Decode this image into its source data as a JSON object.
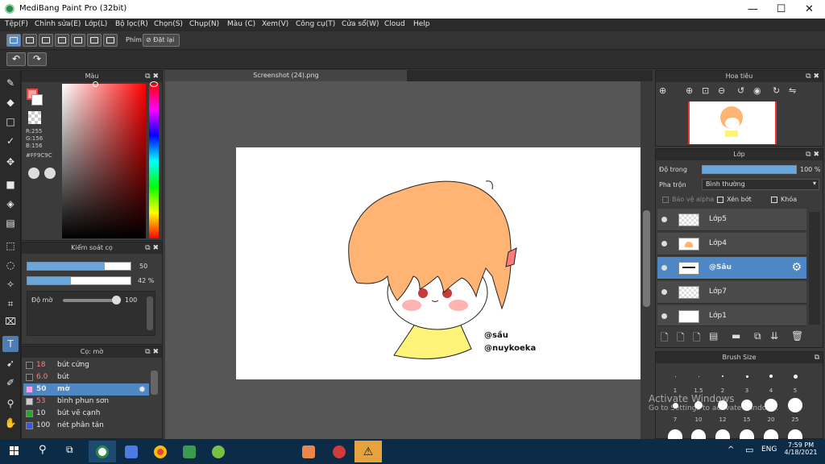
{
  "window": {
    "title": "MediBang Paint Pro (32bit)",
    "min_glyph": "—",
    "max_glyph": "☐",
    "close_glyph": "✕"
  },
  "menu": [
    "Tệp(F)",
    "Chỉnh sửa(E)",
    "Lớp(L)",
    "Bộ lọc(R)",
    "Chọn(S)",
    "Chụp(N)",
    "Màu (C)",
    "Xem(V)",
    "Công cụ(T)",
    "Cửa sổ(W)",
    "Cloud",
    "Help"
  ],
  "toolbar": {
    "phim_label": "Phím",
    "reset_label": "Đặt lại"
  },
  "color_panel": {
    "title": "Màu",
    "r": "R:255",
    "g": "G:156",
    "b": "B:156",
    "hex": "#FF9C9C",
    "fg_color": "#FF9C9C"
  },
  "brush_control": {
    "title": "Kiểm soát cọ",
    "size_value": "50",
    "opacity_value": "42 %",
    "opacity_level": 0.42,
    "blur_label": "Độ mờ",
    "blur_value": "100"
  },
  "brush_panel": {
    "title": "Cọ: mờ",
    "items": [
      {
        "size": "18",
        "name": "bút cứng",
        "color": "#333333"
      },
      {
        "size": "6.0",
        "name": "bút",
        "color": "#333333"
      },
      {
        "size": "50",
        "name": "mờ",
        "color": "#ff9cff"
      },
      {
        "size": "53",
        "name": "bình phun sơn",
        "color": "#cccccc"
      },
      {
        "size": "10",
        "name": "bút vẽ cạnh",
        "color": "#22aa22"
      },
      {
        "size": "100",
        "name": "nét phân tán",
        "color": "#3355ff"
      }
    ]
  },
  "canvas": {
    "tab_title": "Screenshot (24).png",
    "sign1": "@sầu",
    "sign2": "@nuykoeka"
  },
  "navigator": {
    "title": "Hoa tiêu"
  },
  "layer_panel": {
    "title": "Lớp",
    "opacity_label": "Độ trong",
    "opacity_value": "100 %",
    "opacity_level": 1.0,
    "blend_label": "Pha trộn",
    "blend_value": "Bình thường",
    "protect_alpha": "Bảo vệ alpha",
    "clip": "Xén bớt",
    "lock": "Khóa",
    "layers": [
      "Lớp5",
      "Lớp4",
      "@Sâu",
      "Lớp7",
      "Lớp1"
    ]
  },
  "brush_size": {
    "title": "Brush Size",
    "labels_row1": [
      "1",
      "1.5",
      "2",
      "3",
      "4",
      "5"
    ],
    "labels_row2": [
      "7",
      "10",
      "12",
      "15",
      "20",
      "25"
    ]
  },
  "watermark": {
    "line1": "Activate Windows",
    "line2": "Go to Settings to activate Windows."
  },
  "taskbar": {
    "time": "7:59 PM",
    "date": "4/18/2021",
    "lang": "ENG"
  }
}
